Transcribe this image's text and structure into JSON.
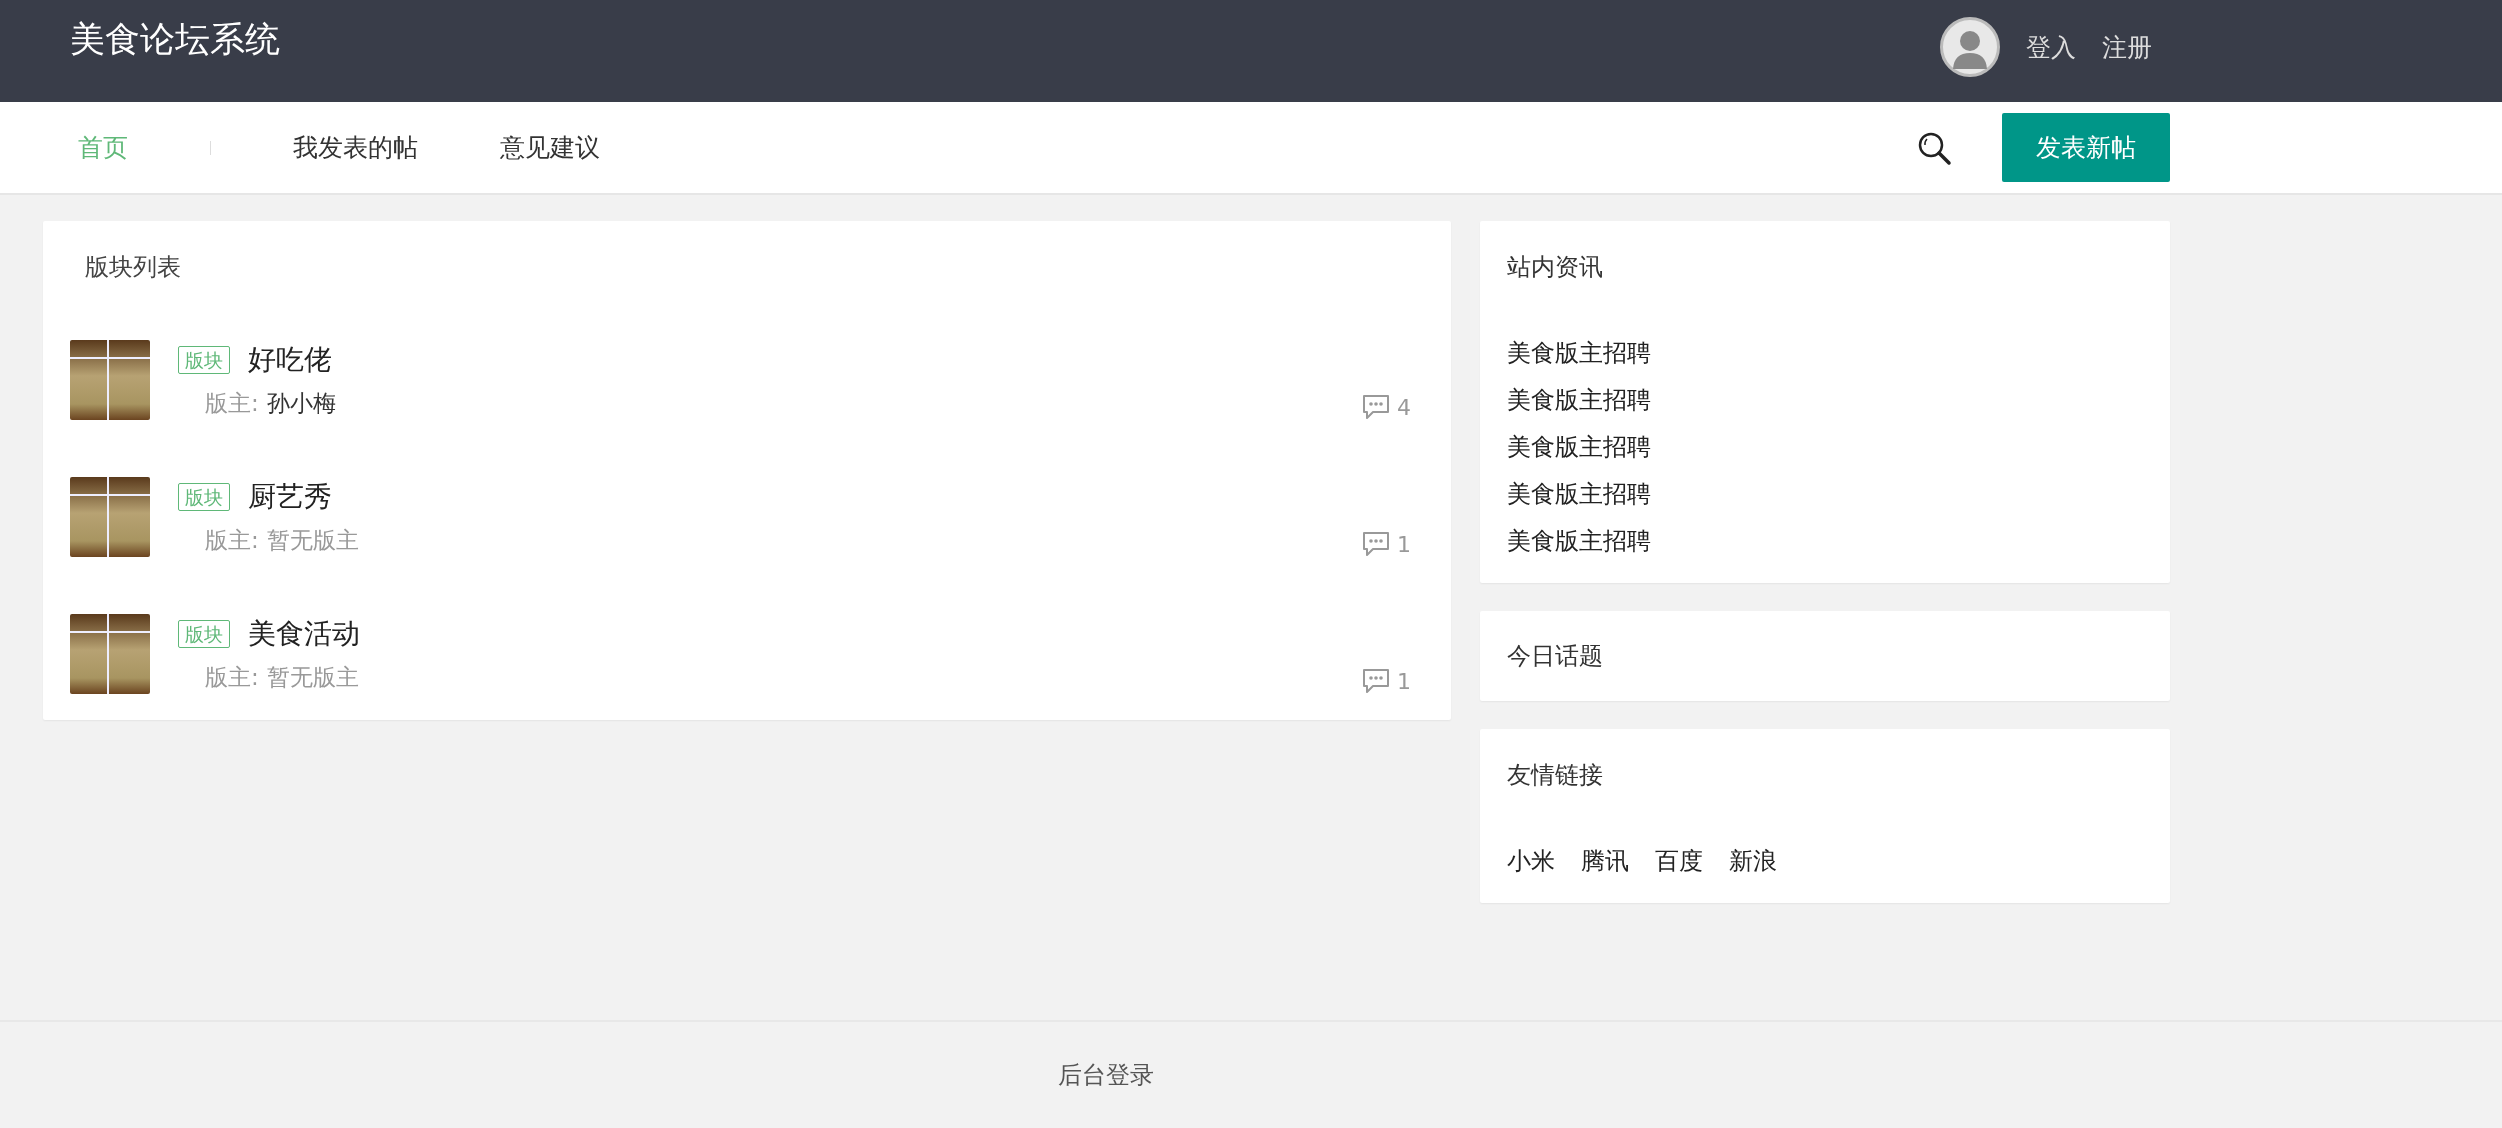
{
  "header": {
    "title": "美食论坛系统",
    "auth_links": [
      "登入",
      "注册"
    ]
  },
  "nav": {
    "items": [
      {
        "label": "首页",
        "selected": true
      },
      {
        "label": "我发表的帖",
        "selected": false
      },
      {
        "label": "意见建议",
        "selected": false
      }
    ],
    "post_button": "发表新帖"
  },
  "boards": {
    "title": "版块列表",
    "items": [
      {
        "tag": "版块",
        "name": "好吃佬",
        "moderator_label": "版主:",
        "moderator": "孙小梅",
        "moderator_assigned": true,
        "comments": "4"
      },
      {
        "tag": "版块",
        "name": "厨艺秀",
        "moderator_label": "版主:",
        "moderator": "暂无版主",
        "moderator_assigned": false,
        "comments": "1"
      },
      {
        "tag": "版块",
        "name": "美食活动",
        "moderator_label": "版主:",
        "moderator": "暂无版主",
        "moderator_assigned": false,
        "comments": "1"
      }
    ]
  },
  "sidebar": [
    {
      "kind": "list",
      "title": "站内资讯",
      "items": [
        "美食版主招聘",
        "美食版主招聘",
        "美食版主招聘",
        "美食版主招聘",
        "美食版主招聘"
      ]
    },
    {
      "kind": "title_only",
      "title": "今日话题"
    },
    {
      "kind": "links",
      "title": "友情链接",
      "items": [
        "小米",
        "腾讯",
        "百度",
        "新浪"
      ]
    }
  ],
  "footer": {
    "link": "后台登录"
  }
}
